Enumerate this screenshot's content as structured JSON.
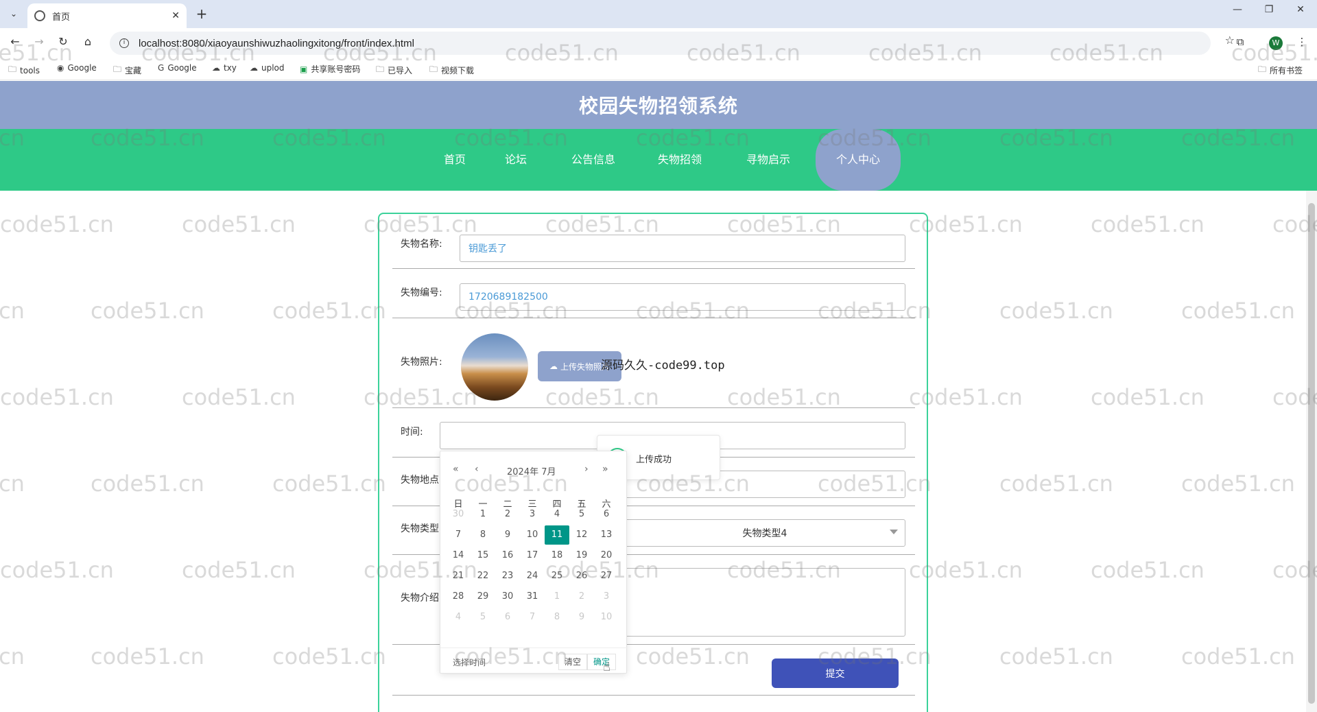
{
  "browser": {
    "tab_title": "首页",
    "url": "localhost:8080/xiaoyaunshiwuzhaolingxitong/front/index.html",
    "avatar_letter": "W",
    "bookmarks": [
      "tools",
      "Google",
      "宝藏",
      "Google",
      "txy",
      "uplod",
      "共享账号密码",
      "已导入",
      "视频下载"
    ],
    "all_bookmarks": "所有书签"
  },
  "site": {
    "title": "校园失物招领系统",
    "nav": [
      "首页",
      "论坛",
      "公告信息",
      "失物招领",
      "寻物启示",
      "个人中心"
    ],
    "active_nav": "个人中心",
    "colors": {
      "header": "#8ea2cc",
      "nav": "#2ec987",
      "submit": "#3f52b8",
      "today": "#009688"
    }
  },
  "form": {
    "name_label": "失物名称:",
    "name_value": "钥匙丢了",
    "code_label": "失物编号:",
    "code_value": "1720689182500",
    "photo_label": "失物照片:",
    "upload_label": "上传失物照片",
    "promo_text": "源码久久-code99.top",
    "time_label": "时间:",
    "place_label": "失物地点",
    "type_label": "失物类型",
    "type_value": "失物类型4",
    "intro_label": "失物介绍",
    "submit_label": "提交"
  },
  "toast": {
    "message": "上传成功"
  },
  "datepicker": {
    "year_month": "2024年  7月",
    "weekdays": [
      "日",
      "一",
      "二",
      "三",
      "四",
      "五",
      "六"
    ],
    "weeks": [
      [
        "30",
        "1",
        "2",
        "3",
        "4",
        "5",
        "6"
      ],
      [
        "7",
        "8",
        "9",
        "10",
        "11",
        "12",
        "13"
      ],
      [
        "14",
        "15",
        "16",
        "17",
        "18",
        "19",
        "20"
      ],
      [
        "21",
        "22",
        "23",
        "24",
        "25",
        "26",
        "27"
      ],
      [
        "28",
        "29",
        "30",
        "31",
        "1",
        "2",
        "3"
      ],
      [
        "4",
        "5",
        "6",
        "7",
        "8",
        "9",
        "10"
      ]
    ],
    "selected_day": "11",
    "select_time_label": "选择时间",
    "clear_label": "清空",
    "confirm_label": "确定"
  },
  "watermark": "code51.cn"
}
